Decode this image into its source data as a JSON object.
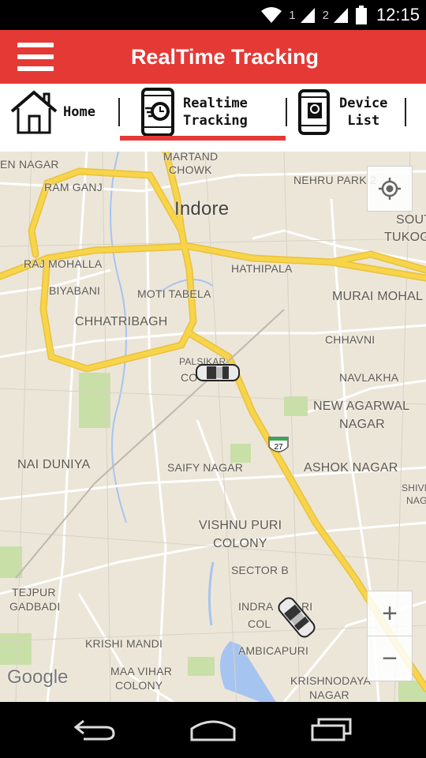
{
  "status_bar": {
    "sim1": "1",
    "sim2": "2",
    "time": "12:15"
  },
  "app_bar": {
    "title": "RealTime Tracking"
  },
  "tabs": [
    {
      "label_line1": "Home",
      "label_line2": "",
      "icon": "house-icon"
    },
    {
      "label_line1": "Realtime",
      "label_line2": "Tracking",
      "icon": "phone-tracking-icon",
      "selected": true
    },
    {
      "label_line1": "Device",
      "label_line2": "List",
      "icon": "phone-device-icon"
    }
  ],
  "colors": {
    "accent": "#e53935",
    "map_bg": "#ece6d9",
    "major_road": "#f7d44a",
    "water": "#a6c4f0",
    "park": "#c9dfa8"
  },
  "map": {
    "city": "Indore",
    "places": [
      "EN NAGAR",
      "MARTAND",
      "CHOWK",
      "NEHRU PARK 2",
      "RAM GANJ",
      "SOUT",
      "TUKOG",
      "RAJ MOHALLA",
      "HATHIPALA",
      "BIYABANI",
      "MOTI TABELA",
      "MURAI MOHAL",
      "CHHATRIBAGH",
      "CHHAVNI",
      "PALSIKAR",
      "CO",
      "NAVLAKHA",
      "NEW AGARWAL",
      "NAGAR",
      "SAIFY NAGAR",
      "ASHOK NAGAR",
      "NAI DUNIYA",
      "SHIVN",
      "NAG",
      "VISHNU PURI",
      "COLONY",
      "SECTOR B",
      "TEJPUR",
      "GADBADI",
      "INDRA",
      "RI",
      "COL",
      "KRISHI MANDI",
      "AMBICAPURI",
      "MAA VIHAR",
      "COLONY",
      "KRISHNODAYA",
      "NAGAR"
    ],
    "highway_shield": "27",
    "attribution": "Google",
    "zoom_in": "+",
    "zoom_out": "−"
  }
}
